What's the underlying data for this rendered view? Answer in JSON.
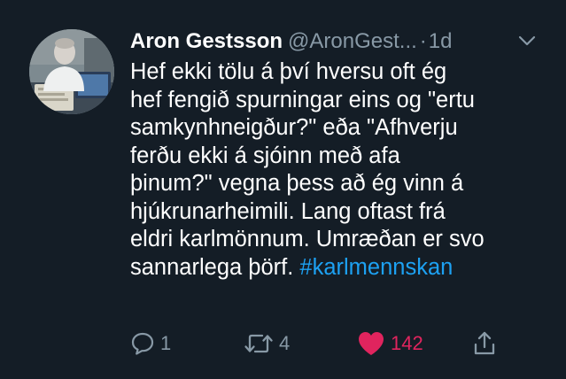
{
  "tweet": {
    "author_name": "Aron Gestsson",
    "author_handle": "@AronGest...",
    "separator": "·",
    "timestamp": "1d",
    "body_lines": [
      "Hef ekki tölu á því hversu oft ég",
      "hef fengið spurningar eins og \"ertu",
      "samkynhneigður?\" eða \"Afhverju",
      "ferðu ekki á sjóinn með afa",
      "þinum?\" vegna þess að ég vinn á",
      "hjúkrunarheimili. Lang oftast frá",
      "eldri karlmönnum. Umræðan er svo"
    ],
    "last_line_text": "sannarlega þörf.",
    "hashtag": "#karlmennskan",
    "actions": {
      "reply_count": "1",
      "retweet_count": "4",
      "like_count": "142",
      "liked": true
    },
    "icons": {
      "avatar": "user-avatar-photo",
      "menu": "chevron-down-icon",
      "reply": "reply-icon",
      "retweet": "retweet-icon",
      "like": "heart-icon",
      "share": "share-icon"
    },
    "colors": {
      "background": "#141d26",
      "text": "#ffffff",
      "secondary": "#8899a6",
      "link": "#1da1f2",
      "like": "#e0245e"
    }
  }
}
